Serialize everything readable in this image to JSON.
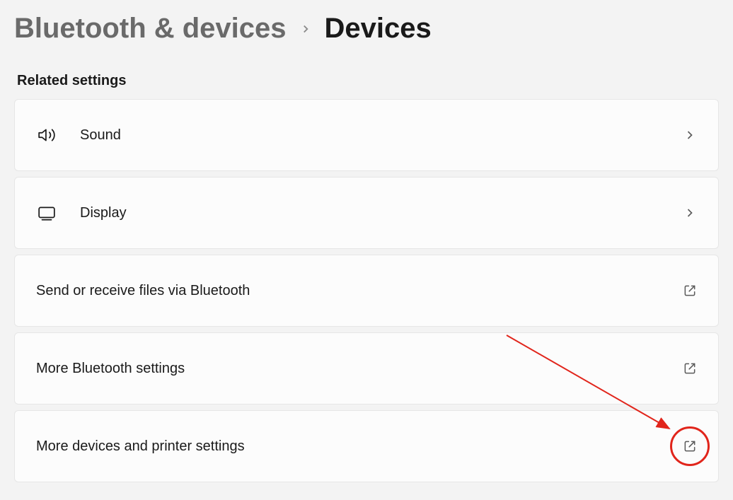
{
  "breadcrumb": {
    "parent": "Bluetooth & devices",
    "current": "Devices"
  },
  "section": {
    "title": "Related settings"
  },
  "items": [
    {
      "label": "Sound",
      "icon": "speaker",
      "action": "chevron"
    },
    {
      "label": "Display",
      "icon": "display",
      "action": "chevron"
    },
    {
      "label": "Send or receive files via Bluetooth",
      "icon": null,
      "action": "external"
    },
    {
      "label": "More Bluetooth settings",
      "icon": null,
      "action": "external"
    },
    {
      "label": "More devices and printer settings",
      "icon": null,
      "action": "external"
    }
  ]
}
